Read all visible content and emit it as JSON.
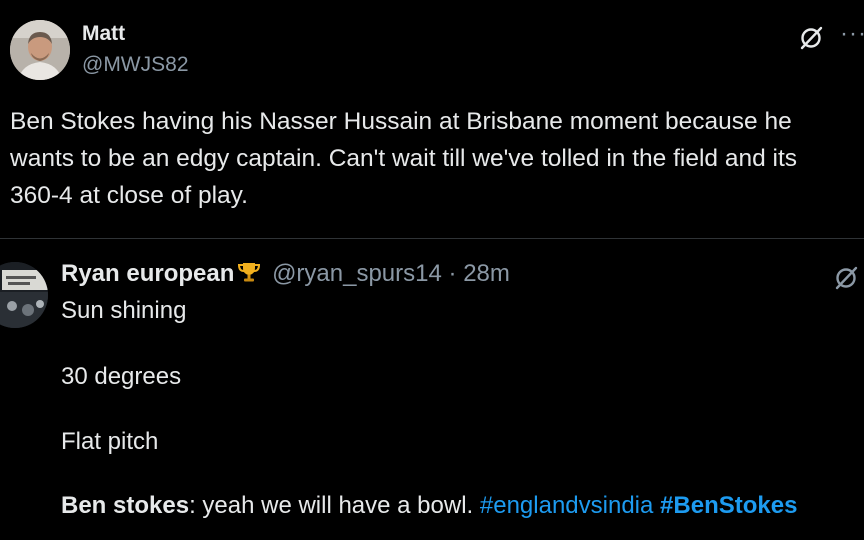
{
  "tweet": {
    "author_name": "Matt",
    "author_handle": "@MWJS82",
    "text": "Ben Stokes having his Nasser Hussain at Brisbane moment because he wants to be an edgy captain. Can't wait till we've tolled in the field and its 360-4 at close of play.",
    "more_icon": "more-icon",
    "logo_icon": "x-logo-icon"
  },
  "reply": {
    "author_name": "Ryan european",
    "badge_icon": "trophy-icon",
    "author_handle": "@ryan_spurs14",
    "separator": "·",
    "time": "28m",
    "lines": [
      "Sun shining",
      "30 degrees",
      "Flat pitch"
    ],
    "final_bold": "Ben stokes",
    "final_text": ": yeah we will have a bowl.",
    "hashtags": [
      "#englandvsindia",
      "#BenStokes"
    ]
  },
  "colors": {
    "background": "#000000",
    "text": "#e7e9ea",
    "secondary": "#8b98a5",
    "link": "#1d9bf0",
    "divider": "#2f3336"
  }
}
